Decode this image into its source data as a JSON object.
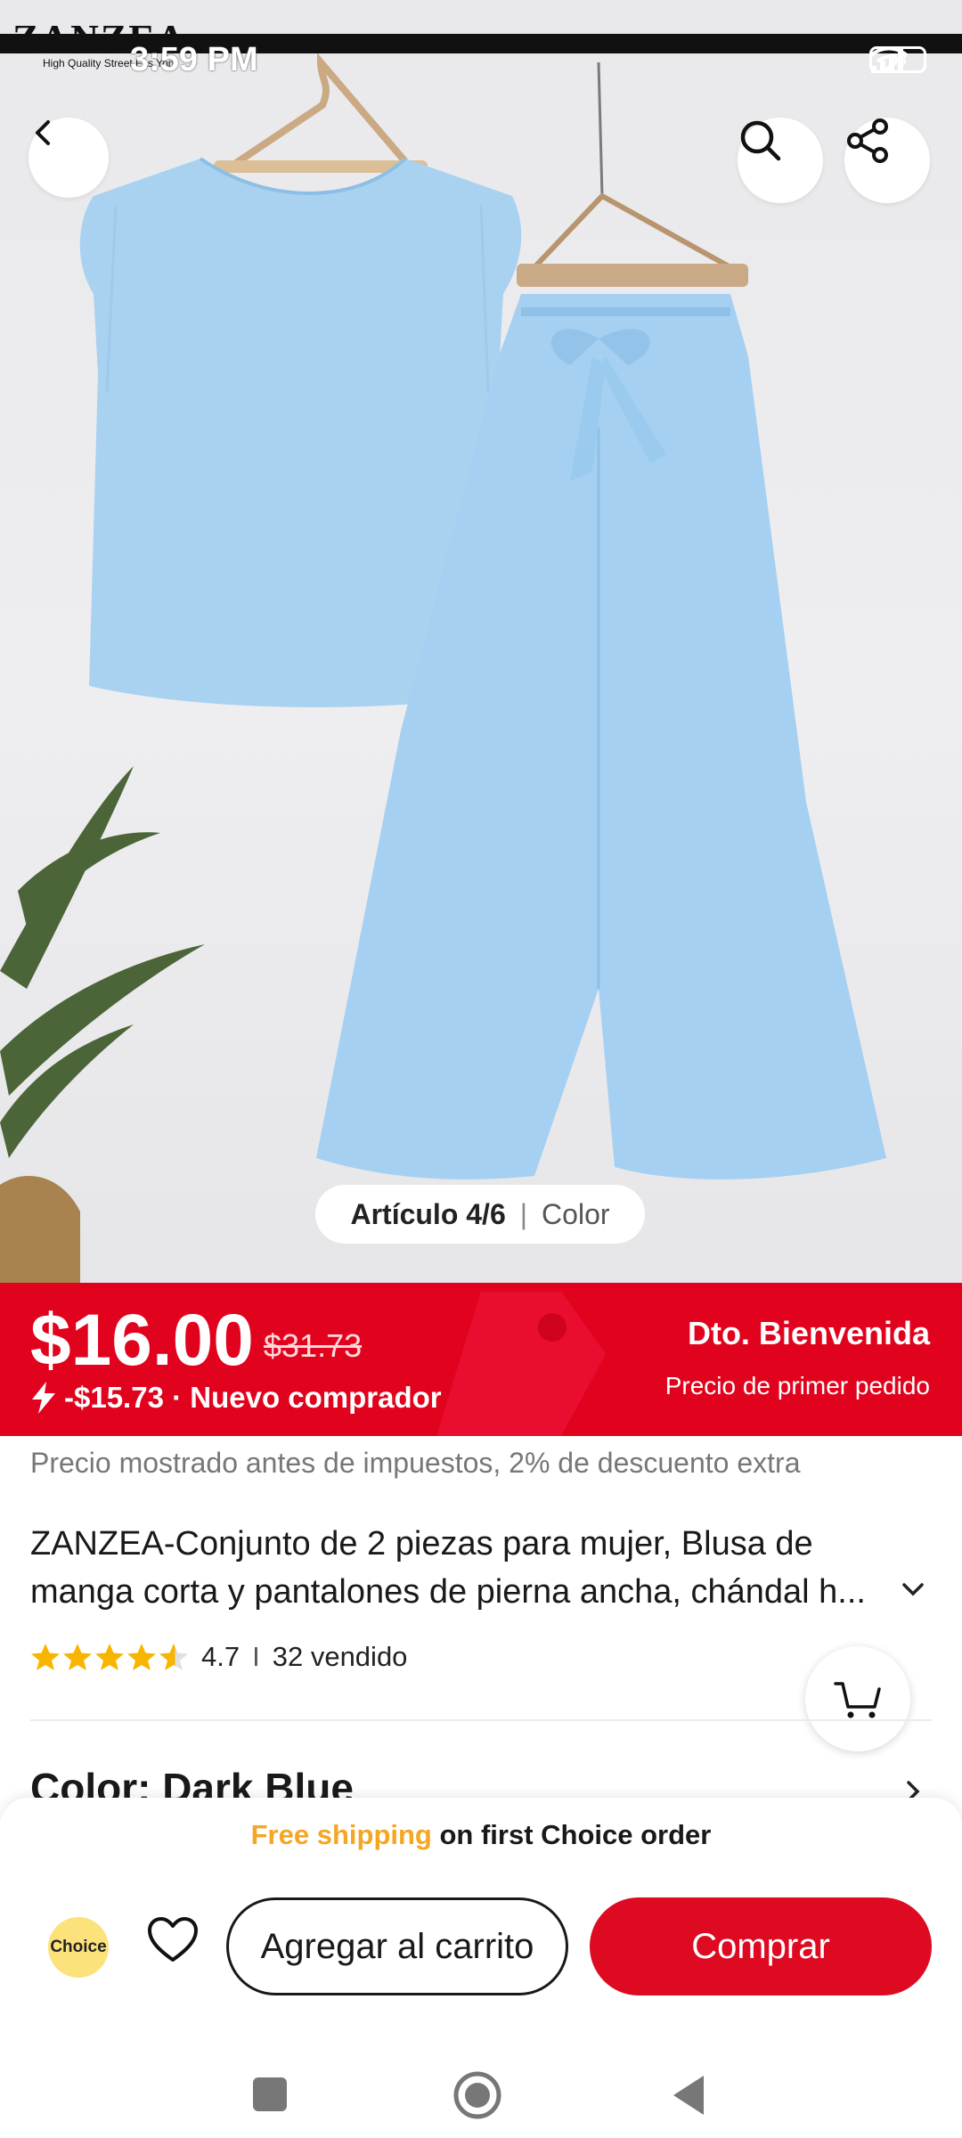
{
  "status_bar": {
    "time": "3:59 PM",
    "battery": "33",
    "brand": "ZANZEA",
    "brand_tagline": "High Quality Street Fas Yon"
  },
  "image": {
    "counter": "Artículo 4/6",
    "separator": "|",
    "color_link": "Color"
  },
  "price": {
    "current": "$16.00",
    "original": "$31.73",
    "discount": "-$15.73 · Nuevo comprador",
    "promo_title": "Dto. Bienvenida",
    "promo_subtitle": "Precio de primer pedido",
    "accent": "#e1031e"
  },
  "details": {
    "tax_note": "Precio mostrado antes de impuestos, 2% de descuento extra",
    "title": "ZANZEA-Conjunto de 2 piezas para mujer, Blusa de manga corta y pantalones de pierna ancha, chándal h...",
    "rating": "4.7",
    "rating_separator": "I",
    "sold": "32 vendido",
    "stars_filled": 4.5,
    "color_label": "Color: Dark Blue"
  },
  "bottom": {
    "shipping_highlight": "Free shipping",
    "shipping_rest": " on first Choice order",
    "choice_badge": "Choice",
    "add_to_cart": "Agregar al carrito",
    "buy": "Comprar",
    "buy_color": "#dd0a22"
  },
  "icons": [
    "back-icon",
    "search-icon",
    "share-icon",
    "cart-icon",
    "heart-icon",
    "chevron-down-icon",
    "chevron-right-icon",
    "lightning-icon",
    "star-icon",
    "nav-recents-icon",
    "nav-home-icon",
    "nav-back-icon"
  ]
}
